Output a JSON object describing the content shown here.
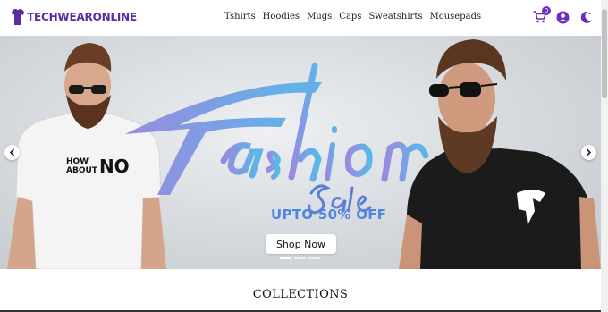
{
  "brand": {
    "name": "TECHWEARONLINE",
    "color": "#5b2da3"
  },
  "nav": {
    "items": [
      "Tshirts",
      "Hoodies",
      "Mugs",
      "Caps",
      "Sweatshirts",
      "Mousepads"
    ]
  },
  "header_icons": {
    "cart_icon": "cart-icon",
    "cart_count": "0",
    "account_icon": "user-circle-icon",
    "theme_icon": "moon-icon",
    "accent": "#6a2fc2"
  },
  "hero": {
    "tshirt_print_line1": "HOW",
    "tshirt_print_line2": "ABOUT",
    "tshirt_print_big": "NO",
    "headline": "Fashion",
    "subheadline": "Sale",
    "offer": "UPTO 50% OFF",
    "cta_label": "Shop Now",
    "prev_icon": "chevron-left-icon",
    "next_icon": "chevron-right-icon",
    "slides": 3,
    "active_slide": 1,
    "gradient": [
      "#9a8ae0",
      "#58b8e8"
    ]
  },
  "collections": {
    "title": "COLLECTIONS"
  }
}
